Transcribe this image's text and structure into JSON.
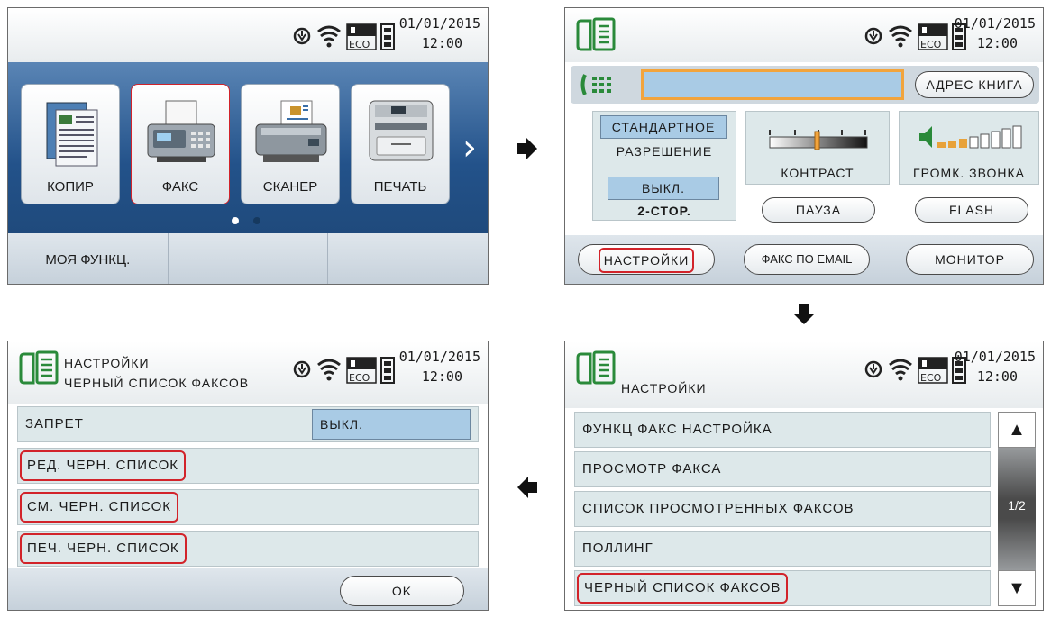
{
  "status": {
    "date": "01/01/2015",
    "time": "12:00",
    "eco": "ECO"
  },
  "colors": {
    "highlight_red": "#d2232a",
    "blue_bg": "#23528a",
    "select_blue": "#a9cbe5",
    "orange_field": "#f2a43c"
  },
  "home": {
    "tiles": [
      {
        "label": "КОПИР",
        "icon": "copier-icon"
      },
      {
        "label": "ФАКС",
        "icon": "fax-icon"
      },
      {
        "label": "СКАНЕР",
        "icon": "scanner-icon"
      },
      {
        "label": "ПЕЧАТЬ",
        "icon": "printer-icon"
      }
    ],
    "next_glyph": "›",
    "bottom": [
      "МОЯ ФУНКЦ.",
      "",
      ""
    ]
  },
  "fax": {
    "address_book": "АДРЕС КНИГА",
    "resolution_value": "СТАНДАРТНОЕ",
    "resolution_label": "РАЗРЕШЕНИЕ",
    "duplex_value": "ВЫКЛ.",
    "duplex_label": "2-СТОР.",
    "contrast_label": "КОНТРАСТ",
    "ringer_label": "ГРОМК. ЗВОНКА",
    "pause": "ПАУЗА",
    "flash": "FLASH",
    "settings": "НАСТРОЙКИ",
    "fax_email": "ФАКС ПО EMAIL",
    "monitor": "МОНИТОР"
  },
  "settings_menu": {
    "title": "НАСТРОЙКИ",
    "items": [
      "ФУНКЦ ФАКС НАСТРОЙКА",
      "ПРОСМОТР ФАКСА",
      "СПИСОК  ПРОСМОТРЕННЫХ ФАКСОВ",
      "ПОЛЛИНГ",
      "ЧЕРНЫЙ СПИСОК ФАКСОВ"
    ],
    "page": "1/2",
    "up": "▲",
    "down": "▼"
  },
  "blacklist": {
    "title_line1": "НАСТРОЙКИ",
    "title_line2": "ЧЕРНЫЙ СПИСОК ФАКСОВ",
    "block_label": "ЗАПРЕТ",
    "block_value": "ВЫКЛ.",
    "items": [
      "РЕД. ЧЕРН. СПИСОК",
      "СМ. ЧЕРН. СПИСОК",
      "ПЕЧ. ЧЕРН. СПИСОК"
    ],
    "ok": "OK"
  },
  "flow_arrows": [
    "arrow-right-icon",
    "arrow-down-icon",
    "arrow-left-icon"
  ]
}
